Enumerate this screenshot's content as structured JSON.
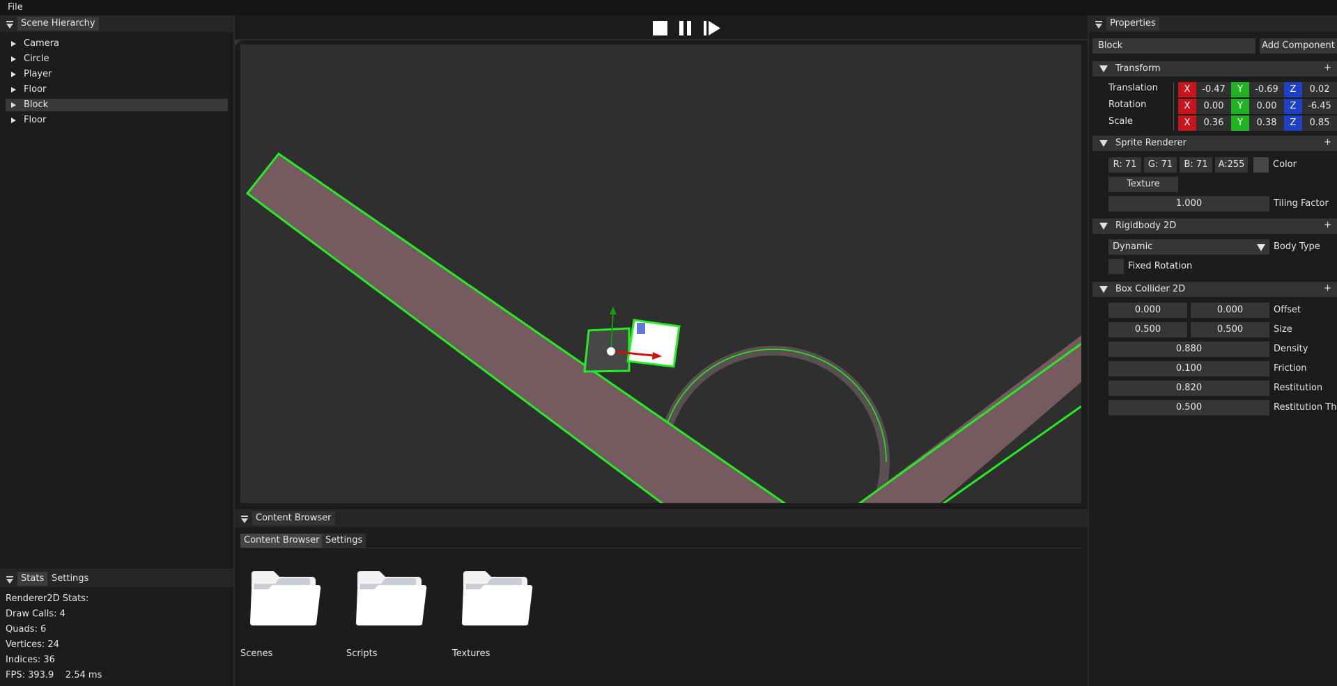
{
  "menu": {
    "file": "File"
  },
  "hierarchy": {
    "title": "Scene Hierarchy",
    "items": [
      {
        "label": "Camera"
      },
      {
        "label": "Circle"
      },
      {
        "label": "Player"
      },
      {
        "label": "Floor"
      },
      {
        "label": "Block",
        "selected": true
      },
      {
        "label": "Floor"
      }
    ]
  },
  "stats": {
    "tabs": [
      "Stats",
      "Settings"
    ],
    "heading": "Renderer2D Stats:",
    "draw_calls": "Draw Calls: 4",
    "quads": "Quads: 6",
    "vertices": "Vertices: 24",
    "indices": "Indices: 36",
    "fps": "FPS: 393.9    2.54 ms"
  },
  "toolbar": {
    "stop_icon": "stop-icon",
    "pause_icon": "pause-icon",
    "step_icon": "step-icon"
  },
  "content_browser": {
    "title": "Content Browser",
    "tabs": [
      "Content Browser",
      "Settings"
    ],
    "folders": [
      {
        "name": "Scenes",
        "icon": "folder-icon"
      },
      {
        "name": "Scripts",
        "icon": "folder-icon"
      },
      {
        "name": "Textures",
        "icon": "folder-icon"
      }
    ]
  },
  "properties": {
    "title": "Properties",
    "entity_name": "Block",
    "add_component": "Add Component",
    "transform": {
      "title": "Transform",
      "plus": "+",
      "rows": [
        {
          "label": "Translation",
          "x": "-0.47",
          "y": "-0.69",
          "z": "0.02"
        },
        {
          "label": "Rotation",
          "x": "0.00",
          "y": "0.00",
          "z": "-6.45"
        },
        {
          "label": "Scale",
          "x": "0.36",
          "y": "0.38",
          "z": "0.85"
        }
      ],
      "axis_x": "X",
      "axis_y": "Y",
      "axis_z": "Z"
    },
    "sprite_renderer": {
      "title": "Sprite Renderer",
      "plus": "+",
      "r": "R: 71",
      "g": "G: 71",
      "b": "B: 71",
      "a": "A:255",
      "color_label": "Color",
      "color_swatch": "#474747",
      "texture_button": "Texture",
      "tiling_value": "1.000",
      "tiling_label": "Tiling Factor"
    },
    "rigidbody": {
      "title": "Rigidbody 2D",
      "plus": "+",
      "body_type_value": "Dynamic",
      "body_type_label": "Body Type",
      "fixed_rotation_label": "Fixed Rotation"
    },
    "box_collider": {
      "title": "Box Collider 2D",
      "plus": "+",
      "offset": [
        "0.000",
        "0.000"
      ],
      "offset_label": "Offset",
      "size": [
        "0.500",
        "0.500"
      ],
      "size_label": "Size",
      "density": "0.880",
      "density_label": "Density",
      "friction": "0.100",
      "friction_label": "Friction",
      "restitution": "0.820",
      "restitution_label": "Restitution",
      "restitution_thr": "0.500",
      "restitution_thr_label": "Restitution Thr"
    }
  },
  "colors": {
    "collider_outline": "#22ee22",
    "floor_fill": "#755a5f",
    "gizmo_x": "#cc1111",
    "gizmo_y": "#119911"
  }
}
